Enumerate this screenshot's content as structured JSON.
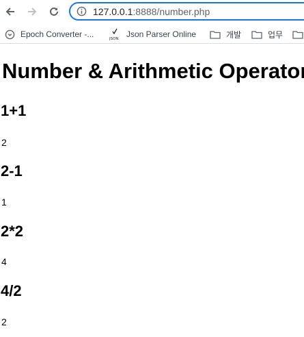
{
  "browser": {
    "url_host": "127.0.0.1",
    "url_rest": ":8888/number.php"
  },
  "bookmarks": [
    {
      "label": "Epoch Converter -...",
      "icon": "clock-icon"
    },
    {
      "label": "Json Parser Online",
      "icon": "json-check-icon"
    },
    {
      "label": "개발",
      "icon": "folder-icon"
    },
    {
      "label": "업무",
      "icon": "folder-icon"
    }
  ],
  "page": {
    "title": "Number & Arithmetic Operator",
    "sections": [
      {
        "heading": "1+1",
        "result": "2"
      },
      {
        "heading": "2-1",
        "result": "1"
      },
      {
        "heading": "2*2",
        "result": "4"
      },
      {
        "heading": "4/2",
        "result": "2"
      }
    ]
  }
}
